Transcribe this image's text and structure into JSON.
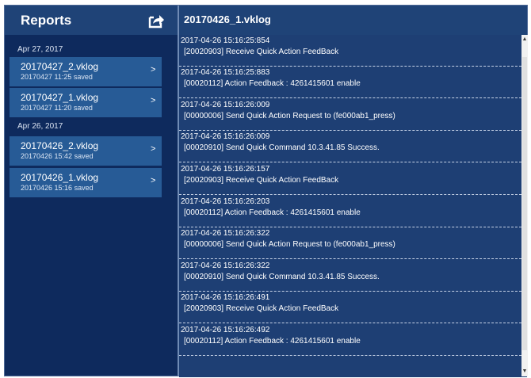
{
  "left_panel": {
    "title": "Reports",
    "export_icon": "export-share-icon",
    "groups": [
      {
        "date": "Apr 27, 2017",
        "items": [
          {
            "name": "20170427_2.vklog",
            "saved": "20170427 11:25 saved"
          },
          {
            "name": "20170427_1.vklog",
            "saved": "20170427 11:20 saved"
          }
        ]
      },
      {
        "date": "Apr 26, 2017",
        "items": [
          {
            "name": "20170426_2.vklog",
            "saved": "20170426 15:42 saved"
          },
          {
            "name": "20170426_1.vklog",
            "saved": "20170426 15:16 saved"
          }
        ]
      }
    ],
    "chevron": ">"
  },
  "right_panel": {
    "title": "20170426_1.vklog",
    "log_entries": [
      {
        "timestamp": "2017-04-26 15:16:25:854",
        "message": "[20020903] Receive Quick Action FeedBack"
      },
      {
        "timestamp": "2017-04-26 15:16:25:883",
        "message": "[00020112] Action Feedback : 4261415601 enable"
      },
      {
        "timestamp": "2017-04-26 15:16:26:009",
        "message": "[00000006] Send Quick Action Request to  (fe000ab1_press)"
      },
      {
        "timestamp": "2017-04-26 15:16:26:009",
        "message": "[00020910] Send Quick Command 10.3.41.85 Success."
      },
      {
        "timestamp": "2017-04-26 15:16:26:157",
        "message": "[20020903] Receive Quick Action FeedBack"
      },
      {
        "timestamp": "2017-04-26 15:16:26:203",
        "message": "[00020112] Action Feedback : 4261415601 enable"
      },
      {
        "timestamp": "2017-04-26 15:16:26:322",
        "message": "[00000006] Send Quick Action Request to  (fe000ab1_press)"
      },
      {
        "timestamp": "2017-04-26 15:16:26:322",
        "message": "[00020910] Send Quick Command 10.3.41.85 Success."
      },
      {
        "timestamp": "2017-04-26 15:16:26:491",
        "message": "[20020903] Receive Quick Action FeedBack"
      },
      {
        "timestamp": "2017-04-26 15:16:26:492",
        "message": "[00020112] Action Feedback : 4261415601 enable"
      }
    ]
  },
  "colors": {
    "panel_bg": "#0e2a5d",
    "header_bg": "#1f4377",
    "item_bg": "#275b96",
    "log_bg": "#1e3f74"
  }
}
